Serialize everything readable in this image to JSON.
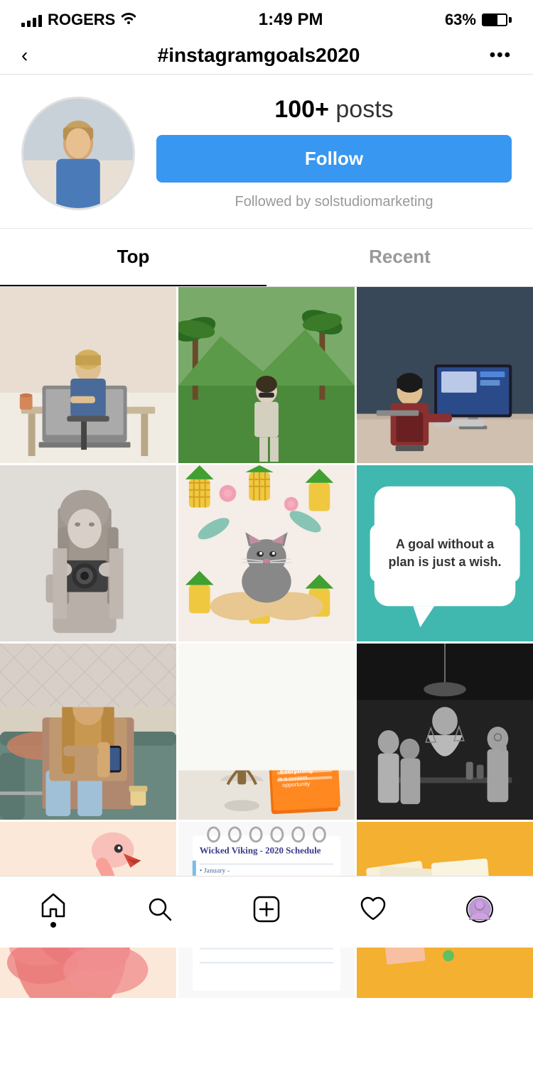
{
  "statusBar": {
    "carrier": "ROGERS",
    "time": "1:49 PM",
    "batteryPercent": "63%"
  },
  "navbar": {
    "title": "#instagramgoals2020",
    "backLabel": "‹",
    "moreLabel": "•••"
  },
  "profile": {
    "postsCount": "100+",
    "postsLabel": "posts",
    "followButton": "Follow",
    "followedByText": "Followed by solstudiomarketing"
  },
  "tabs": [
    {
      "label": "Top",
      "active": true
    },
    {
      "label": "Recent",
      "active": false
    }
  ],
  "grid": {
    "cells": [
      {
        "type": "photo",
        "colorClass": "photo-1",
        "alt": "Woman with laptop at cafe"
      },
      {
        "type": "photo",
        "colorClass": "photo-2",
        "alt": "Woman walking road with palm trees"
      },
      {
        "type": "photo",
        "colorClass": "photo-3",
        "alt": "Woman at computer desk"
      },
      {
        "type": "photo",
        "colorClass": "photo-4",
        "alt": "Black and white woman with camera"
      },
      {
        "type": "photo",
        "colorClass": "photo-5",
        "alt": "Kitten on pineapple fabric"
      },
      {
        "type": "text",
        "colorClass": "photo-6",
        "text": "A goal without a plan is just a wish."
      },
      {
        "type": "photo",
        "colorClass": "photo-7",
        "alt": "Woman on couch with phone"
      },
      {
        "type": "photo",
        "colorClass": "photo-11",
        "alt": "Notepad with plant"
      },
      {
        "type": "photo",
        "colorClass": "photo-9",
        "alt": "Vintage party scene black and white"
      },
      {
        "type": "photo",
        "colorClass": "photo-10",
        "alt": "Bird partial"
      },
      {
        "type": "photo",
        "colorClass": "photo-11",
        "alt": "Wicked Viking 2020 schedule"
      },
      {
        "type": "photo",
        "colorClass": "photo-12",
        "alt": "Orange partial"
      }
    ]
  },
  "bottomNav": {
    "items": [
      {
        "label": "Home",
        "icon": "home-icon",
        "active": true
      },
      {
        "label": "Search",
        "icon": "search-icon",
        "active": false
      },
      {
        "label": "Add",
        "icon": "add-icon",
        "active": false
      },
      {
        "label": "Heart",
        "icon": "heart-icon",
        "active": false
      },
      {
        "label": "Profile",
        "icon": "profile-icon",
        "active": false
      }
    ]
  }
}
